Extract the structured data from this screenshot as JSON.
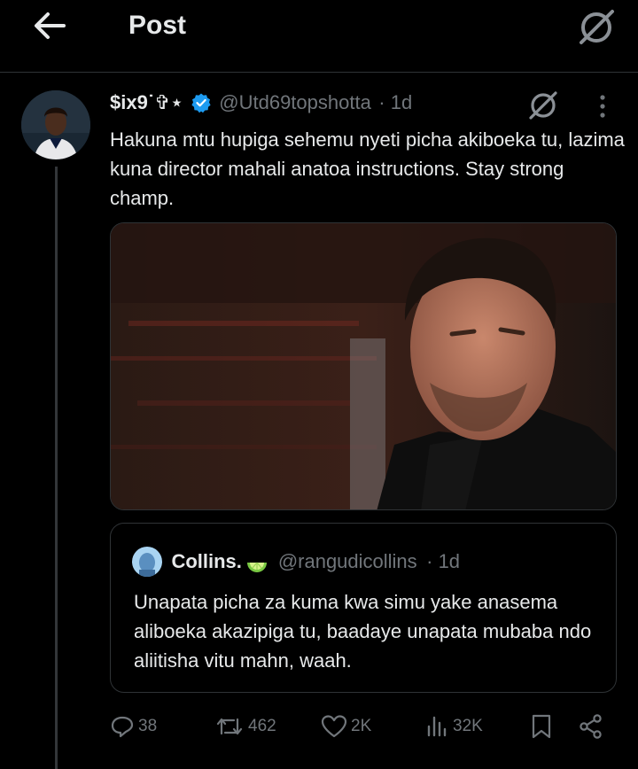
{
  "header": {
    "title": "Post"
  },
  "tweet": {
    "display_name": "$ix9˙✞⋆",
    "handle": "@Utd69topshotta",
    "time": "· 1d",
    "text": "Hakuna mtu hupiga sehemu nyeti picha akiboeka tu, lazima kuna director mahali anatoa instructions. Stay strong champ."
  },
  "quote": {
    "display_name": "Collins.",
    "handle": "@rangudicollins",
    "time": "· 1d",
    "text": "Unapata picha za kuma kwa simu yake anasema aliboeka akazipiga tu, baadaye unapata mubaba ndo aliitisha vitu mahn, waah."
  },
  "actions": {
    "replies": "38",
    "reposts": "462",
    "likes": "2K",
    "views": "32K"
  },
  "colors": {
    "background": "#000000",
    "text": "#e7e9ea",
    "muted": "#71767b",
    "border": "#2f3336",
    "verified": "#1d9bf0"
  },
  "icons": [
    "back-arrow-icon",
    "grok-icon",
    "verified-badge-icon",
    "more-icon",
    "reply-icon",
    "repost-icon",
    "like-icon",
    "views-icon",
    "bookmark-icon",
    "share-icon",
    "lime-emoji-icon"
  ]
}
